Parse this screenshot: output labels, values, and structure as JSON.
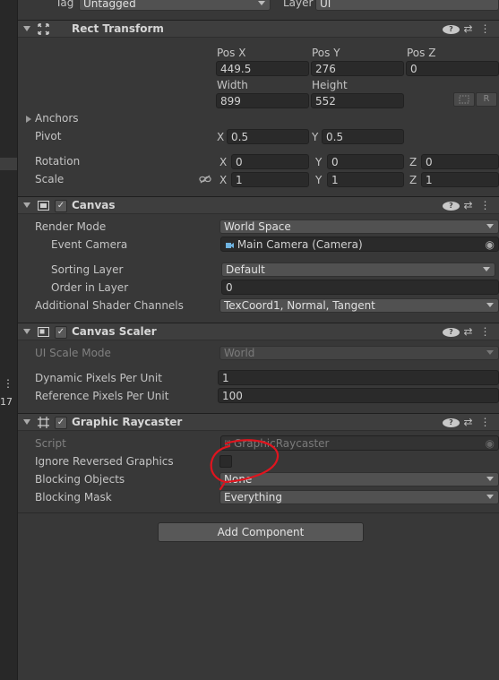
{
  "top": {
    "tag_label": "Tag",
    "tag_value": "Untagged",
    "layer_label": "Layer",
    "layer_value": "UI"
  },
  "left_strip": {
    "dots": "⋮",
    "number": "17"
  },
  "rect_transform": {
    "title": "Rect Transform",
    "posx_label": "Pos X",
    "posy_label": "Pos Y",
    "posz_label": "Pos Z",
    "posx": "449.5",
    "posy": "276",
    "posz": "0",
    "width_label": "Width",
    "height_label": "Height",
    "width": "899",
    "height": "552",
    "r_button": "R",
    "anchors": "Anchors",
    "pivot_label": "Pivot",
    "pivot_x": "0.5",
    "pivot_y": "0.5",
    "rotation_label": "Rotation",
    "rot_x": "0",
    "rot_y": "0",
    "rot_z": "0",
    "scale_label": "Scale",
    "scale_x": "1",
    "scale_y": "1",
    "scale_z": "1",
    "x": "X",
    "y": "Y",
    "z": "Z"
  },
  "canvas": {
    "title": "Canvas",
    "render_mode_label": "Render Mode",
    "render_mode": "World Space",
    "event_camera_label": "Event Camera",
    "event_camera": "Main Camera (Camera)",
    "sorting_layer_label": "Sorting Layer",
    "sorting_layer": "Default",
    "order_label": "Order in Layer",
    "order": "0",
    "shader_label": "Additional Shader Channels",
    "shader": "TexCoord1, Normal, Tangent"
  },
  "canvas_scaler": {
    "title": "Canvas Scaler",
    "ui_scale_label": "UI Scale Mode",
    "ui_scale": "World",
    "dpu_label": "Dynamic Pixels Per Unit",
    "dpu": "1",
    "rppu_label": "Reference Pixels Per Unit",
    "rppu": "100"
  },
  "raycaster": {
    "title": "Graphic Raycaster",
    "script_label": "Script",
    "script": "GraphicRaycaster",
    "ignore_label": "Ignore Reversed Graphics",
    "blocking_objects_label": "Blocking Objects",
    "blocking_objects": "None",
    "blocking_mask_label": "Blocking Mask",
    "blocking_mask": "Everything"
  },
  "add_component": "Add Component",
  "colors": {
    "annotation": "#e0141e",
    "panel": "#383838",
    "header": "#3e3e3e"
  }
}
